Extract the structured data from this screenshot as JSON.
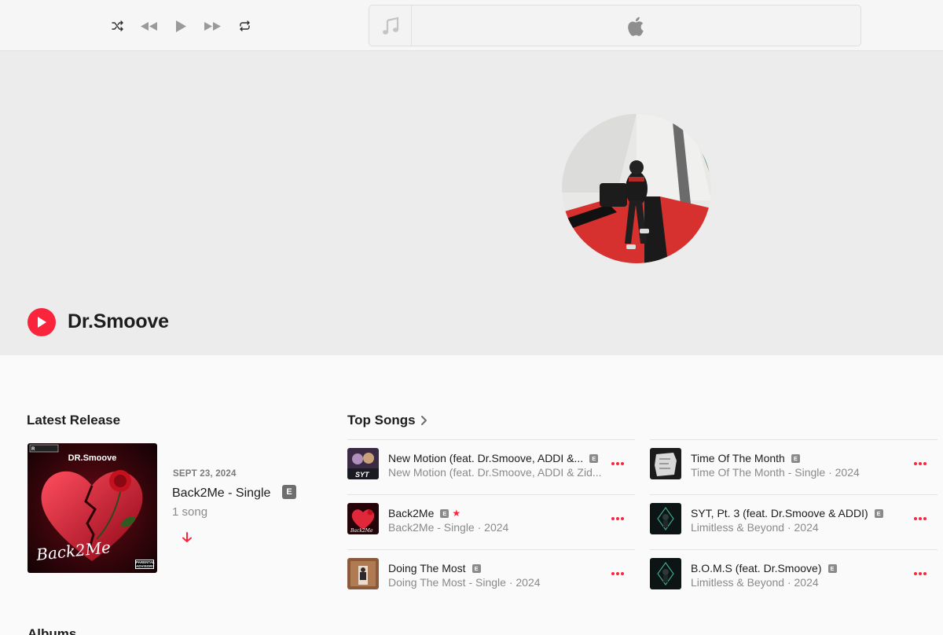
{
  "toolbar": {
    "controls": [
      "shuffle-icon",
      "previous-icon",
      "play-icon",
      "next-icon",
      "repeat-icon"
    ],
    "lcd": {
      "art_icon": "music-note-icon",
      "logo": "apple-logo-icon"
    }
  },
  "artist": {
    "name": "Dr.Smoove",
    "play_icon": "play-icon"
  },
  "latest_release": {
    "heading": "Latest Release",
    "artwork_text": "DR.Smoove",
    "artwork_script": "Back2Me",
    "artwork_badge": "PARENTAL ADVISORY",
    "date": "SEPT 23, 2024",
    "title": "Back2Me - Single",
    "explicit": "E",
    "count": "1 song"
  },
  "top_songs": {
    "heading": "Top Songs",
    "items": [
      {
        "title": "New Motion (feat. Dr.Smoove, ADDI &...",
        "subtitle": "New Motion (feat. Dr.Smoove, ADDI & Zid...",
        "explicit": "E",
        "starred": false,
        "art": "purple"
      },
      {
        "title": "Back2Me",
        "subtitle": "Back2Me - Single · 2024",
        "explicit": "E",
        "starred": true,
        "art": "heart"
      },
      {
        "title": "Doing The Most",
        "subtitle": "Doing The Most - Single · 2024",
        "explicit": "E",
        "starred": false,
        "art": "brown"
      },
      {
        "title": "Time Of The Month",
        "subtitle": "Time Of The Month - Single · 2024",
        "explicit": "E",
        "starred": false,
        "art": "grey"
      },
      {
        "title": "SYT, Pt. 3 (feat. Dr.Smoove & ADDI)",
        "subtitle": "Limitless & Beyond · 2024",
        "explicit": "E",
        "starred": false,
        "art": "dark"
      },
      {
        "title": "B.O.M.S (feat. Dr.Smoove)",
        "subtitle": "Limitless & Beyond · 2024",
        "explicit": "E",
        "starred": false,
        "art": "dark"
      }
    ]
  },
  "albums": {
    "heading": "Albums"
  },
  "colors": {
    "accent": "#fa243c",
    "hero_bg": "#ececec",
    "page_bg": "#fafafa"
  }
}
